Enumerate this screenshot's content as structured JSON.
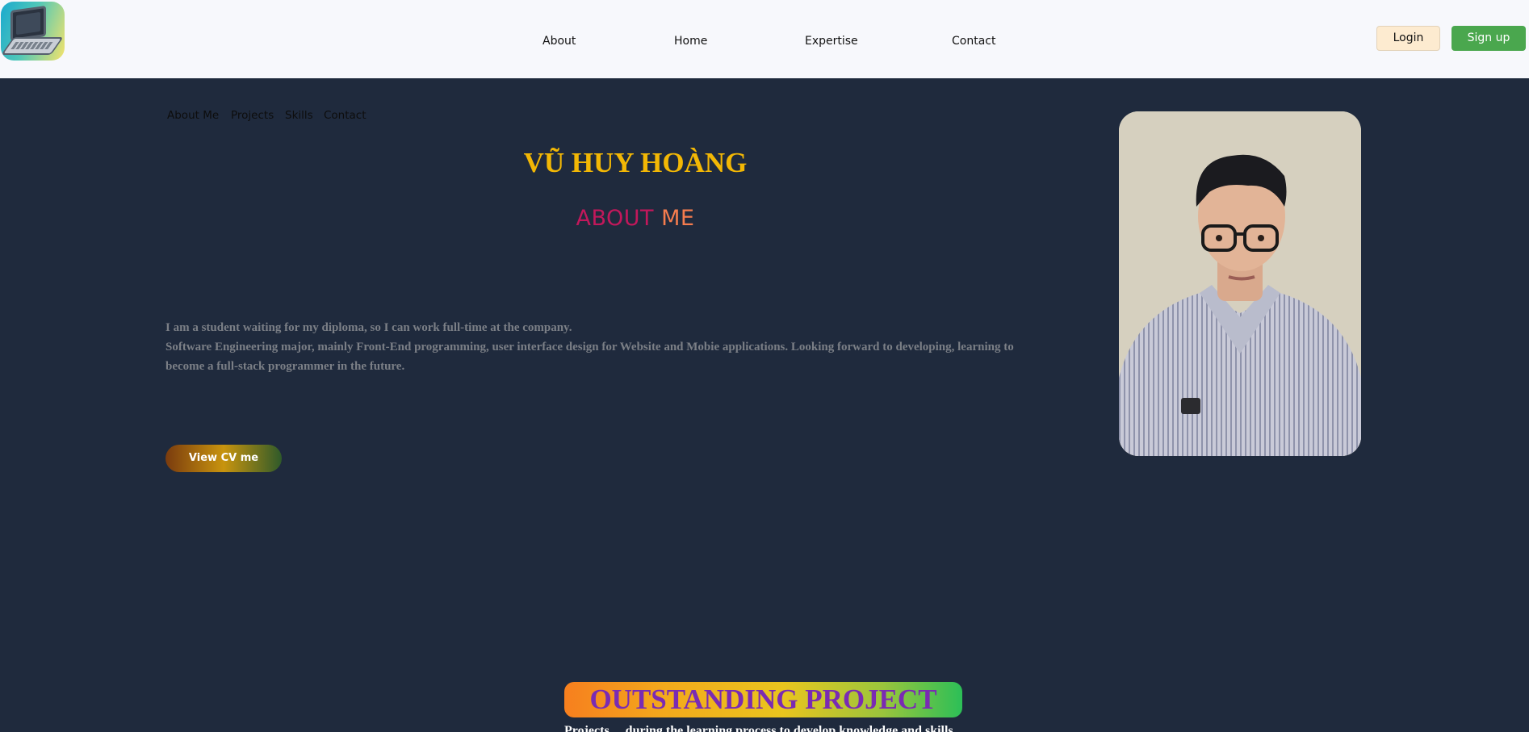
{
  "header": {
    "logo_icon": "laptop-icon",
    "nav": [
      "About",
      "Home",
      "Expertise",
      "Contact"
    ],
    "login_label": "Login",
    "signup_label": "Sign up"
  },
  "subnav": [
    "About Me",
    "Projects",
    "Skills",
    "Contact"
  ],
  "hero": {
    "name": "VŨ HUY HOÀNG",
    "about_word1": "ABOUT",
    "about_word2": "ME",
    "bio_line1": "I am a student waiting for my diploma, so I can work full-time at the company.",
    "bio_line2": "Software Engineering major, mainly Front-End programming, user interface design for Website and Mobie applications. Looking forward to developing, learning to",
    "bio_line3": "become a full-stack programmer in the future.",
    "cv_button": "View CV me"
  },
  "projects": {
    "title": "OUTSTANDING PROJECT",
    "tagline": "Projects ... during the learning process to develop knowledge and skills"
  },
  "colors": {
    "background": "#1f2a3d",
    "header_bg": "#f7f8fc",
    "name_color": "#f2b705",
    "signup_green": "#4aa74e"
  }
}
